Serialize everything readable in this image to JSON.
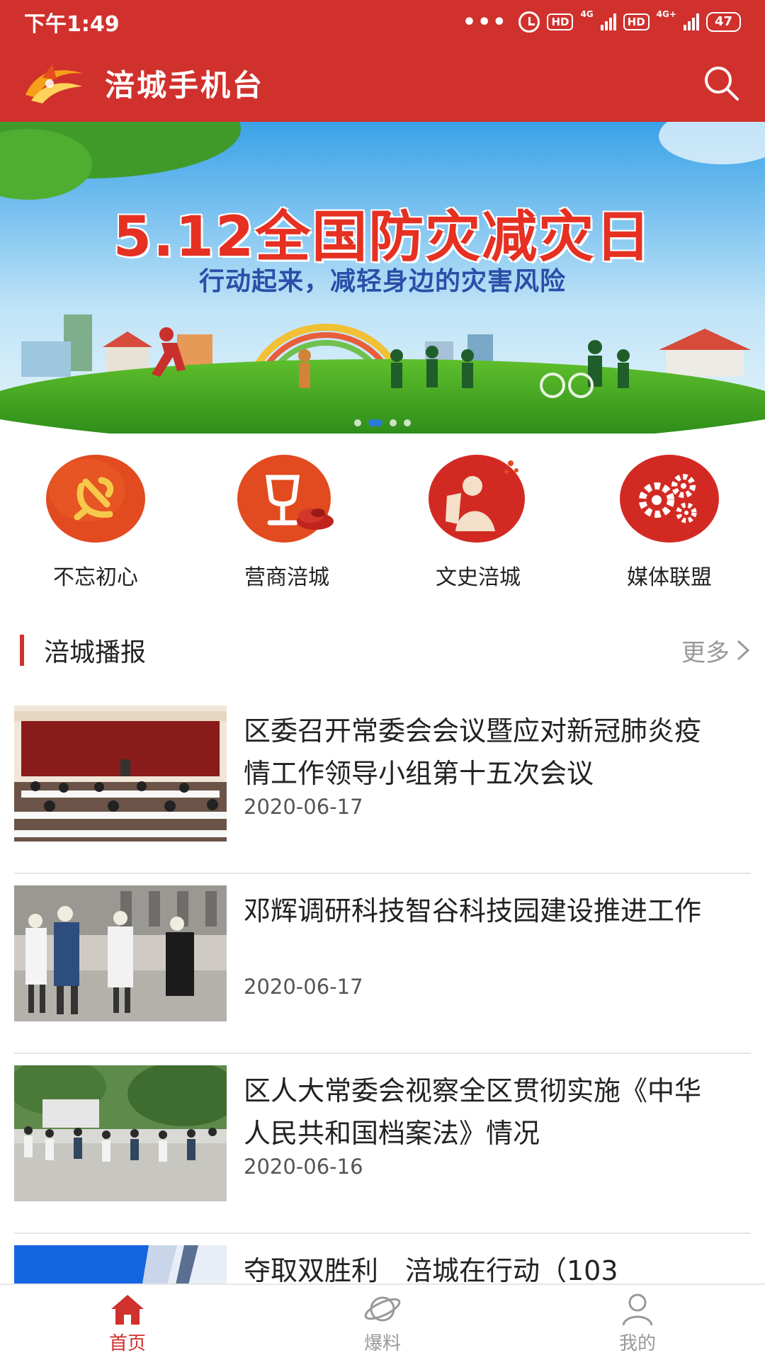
{
  "status_bar": {
    "time": "下午1:49",
    "hd1": "HD",
    "net1": "4G",
    "hd2": "HD",
    "net2": "4G+",
    "battery": "47"
  },
  "header": {
    "title": "涪城手机台"
  },
  "banner": {
    "title": "5.12全国防灾减灾日",
    "subtitle": "行动起来，减轻身边的灾害风险",
    "dots": 4,
    "active_dot": 1
  },
  "quick_links": [
    {
      "label": "不忘初心",
      "icon": "party-emblem-icon"
    },
    {
      "label": "营商涪城",
      "icon": "trophy-icon"
    },
    {
      "label": "文史涪城",
      "icon": "scholar-icon"
    },
    {
      "label": "媒体联盟",
      "icon": "gears-icon"
    }
  ],
  "section": {
    "title": "涪城播报",
    "more": "更多"
  },
  "news": [
    {
      "title": "区委召开常委会会议暨应对新冠肺炎疫情工作领导小组第十五次会议",
      "date": "2020-06-17"
    },
    {
      "title": "邓辉调研科技智谷科技园建设推进工作",
      "date": "2020-06-17"
    },
    {
      "title": "区人大常委会视察全区贯彻实施《中华人民共和国档案法》情况",
      "date": "2020-06-16"
    },
    {
      "title": "夺取双胜利　涪城在行动（103",
      "date": ""
    }
  ],
  "bottom_nav": [
    {
      "label": "首页",
      "icon": "home-icon",
      "active": true
    },
    {
      "label": "爆料",
      "icon": "planet-icon",
      "active": false
    },
    {
      "label": "我的",
      "icon": "user-icon",
      "active": false
    }
  ],
  "colors": {
    "brand": "#d0312d",
    "text": "#222222",
    "muted": "#999999"
  }
}
